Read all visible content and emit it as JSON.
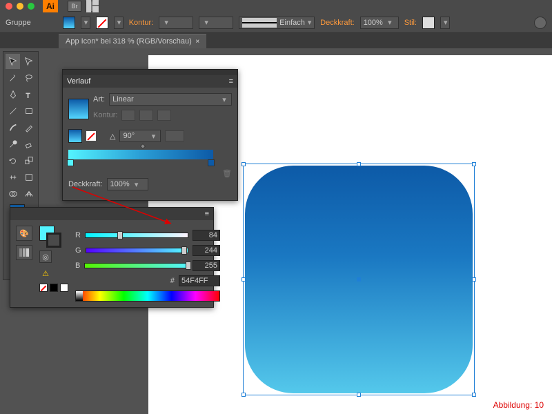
{
  "window": {
    "app": "Ai"
  },
  "selection_label": "Gruppe",
  "controlbar": {
    "kontur_label": "Kontur:",
    "stroke_style": "Einfach",
    "opacity_label": "Deckkraft:",
    "opacity_value": "100%",
    "style_label": "Stil:"
  },
  "document_tab": "App Icon* bei 318 % (RGB/Vorschau)",
  "gradient_panel": {
    "title": "Verlauf",
    "art_label": "Art:",
    "art_value": "Linear",
    "kontur_label": "Kontur:",
    "angle_value": "90°",
    "opacity_label": "Deckkraft:",
    "opacity_value": "100%"
  },
  "color_panel": {
    "r_label": "R",
    "r_value": "84",
    "g_label": "G",
    "g_value": "244",
    "b_label": "B",
    "b_value": "255",
    "hex_prefix": "#",
    "hex_value": "54F4FF"
  },
  "caption": "Abbildung: 10",
  "colors": {
    "swatch_current": "#54F4FF",
    "grad_dark": "#0d5aa7"
  }
}
